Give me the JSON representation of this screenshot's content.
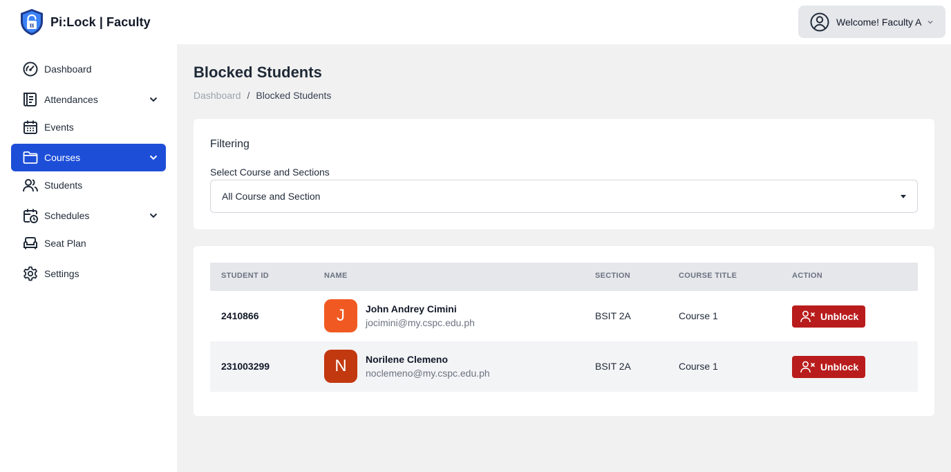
{
  "app": {
    "title": "Pi:Lock | Faculty"
  },
  "header": {
    "welcome": "Welcome! Faculty A",
    "user_icon": "user-circle-icon"
  },
  "sidebar": {
    "items": [
      {
        "label": "Dashboard",
        "icon": "gauge-icon",
        "expandable": false,
        "active": false
      },
      {
        "label": "Attendances",
        "icon": "scroll-icon",
        "expandable": true,
        "active": false
      },
      {
        "label": "Events",
        "icon": "calendar-icon",
        "expandable": false,
        "active": false
      },
      {
        "label": "Courses",
        "icon": "folder-icon",
        "expandable": true,
        "active": true
      },
      {
        "label": "Students",
        "icon": "users-icon",
        "expandable": false,
        "active": false
      },
      {
        "label": "Schedules",
        "icon": "calendar-clock-icon",
        "expandable": true,
        "active": false
      },
      {
        "label": "Seat Plan",
        "icon": "sofa-icon",
        "expandable": false,
        "active": false
      },
      {
        "label": "Settings",
        "icon": "gear-icon",
        "expandable": false,
        "active": false
      }
    ]
  },
  "page": {
    "title": "Blocked Students",
    "breadcrumb": {
      "parent": "Dashboard",
      "separator": "/",
      "current": "Blocked Students"
    }
  },
  "filter": {
    "title": "Filtering",
    "label": "Select Course and Sections",
    "selected": "All Course and Section"
  },
  "table": {
    "headers": {
      "student_id": "STUDENT ID",
      "name": "NAME",
      "section": "SECTION",
      "course_title": "COURSE TITLE",
      "action": "ACTION"
    },
    "rows": [
      {
        "student_id": "2410866",
        "initial": "J",
        "avatar_color": "#f05a22",
        "name": "John Andrey Cimini",
        "email": "jocimini@my.cspc.edu.ph",
        "section": "BSIT 2A",
        "course_title": "Course 1",
        "action": "Unblock"
      },
      {
        "student_id": "231003299",
        "initial": "N",
        "avatar_color": "#c2380f",
        "name": "Norilene Clemeno",
        "email": "noclemeno@my.cspc.edu.ph",
        "section": "BSIT 2A",
        "course_title": "Course 1",
        "action": "Unblock"
      }
    ]
  },
  "colors": {
    "accent": "#1d4ed8",
    "danger": "#b91c1c",
    "main_bg": "#f1f1f1"
  }
}
